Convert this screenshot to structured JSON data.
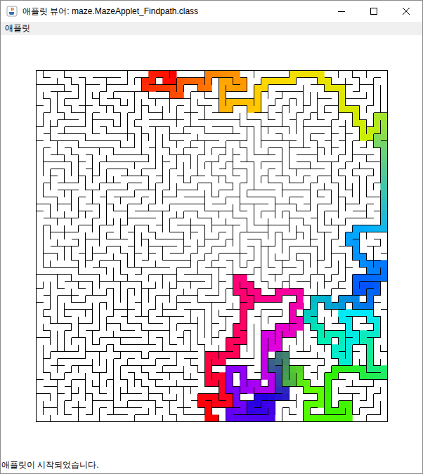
{
  "window": {
    "title": "애플릿 뷰어: maze.MazeApplet_Findpath.class"
  },
  "menu": [
    "애플릿"
  ],
  "maze": {
    "cols": 50,
    "rows": 50,
    "path_color_stops": [
      "#ff0000",
      "#ff8c00",
      "#ffd800",
      "#c8f000",
      "#00b0ff",
      "#0050ff",
      "#00f0b0",
      "#00e8ff",
      "#30f000",
      "#60ff00",
      "#2000e0",
      "#8000ff",
      "#e000e0",
      "#ff0080",
      "#ff0050",
      "#ff0000"
    ]
  },
  "status_bar": "애플릿이 시작되었습니다."
}
